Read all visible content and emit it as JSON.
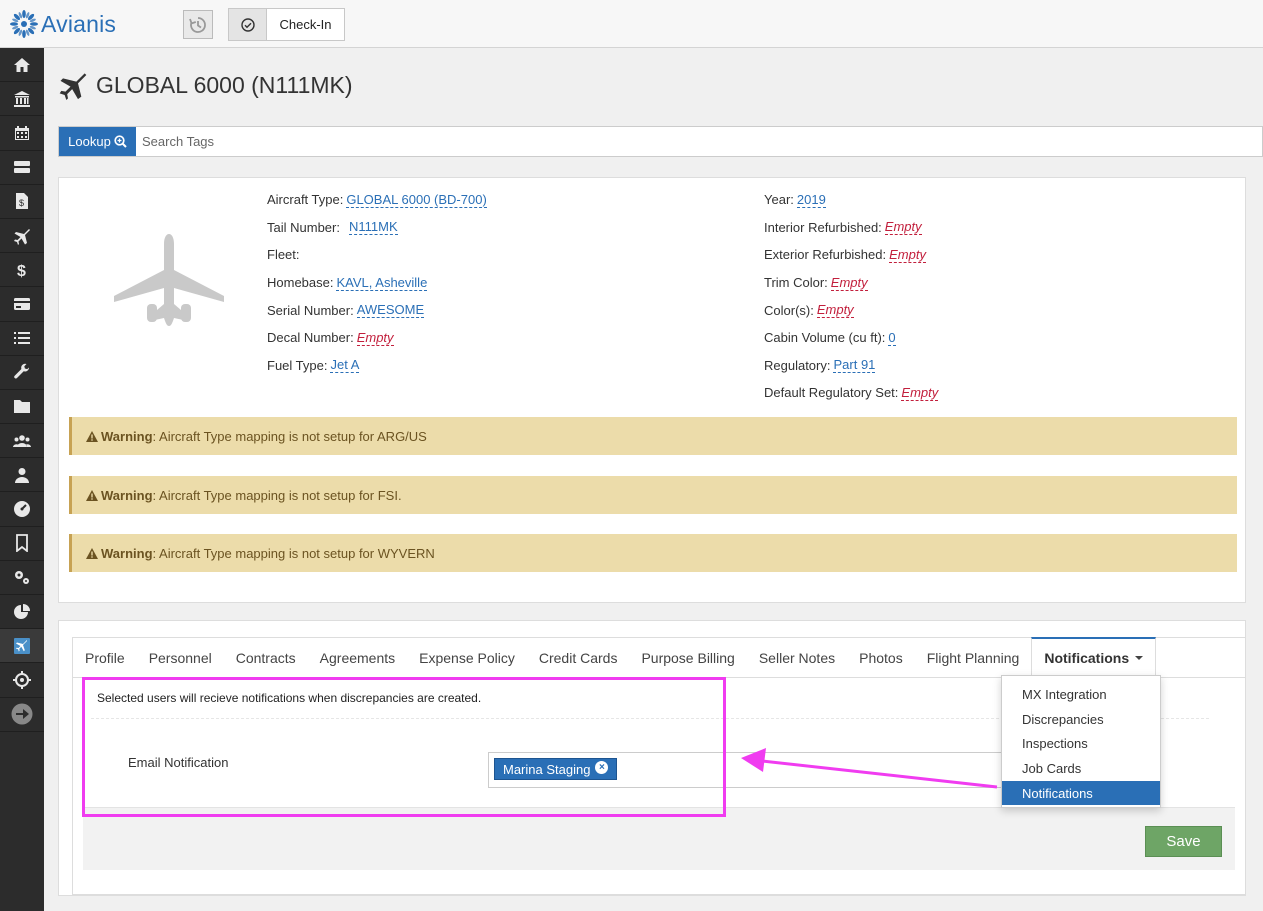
{
  "app": {
    "brand": "Avianis",
    "checkin_label": "Check-In",
    "brand_color": "#2a6fb6"
  },
  "sidebar": {
    "items": [
      "home-icon",
      "bank-icon",
      "calendar-icon",
      "server-icon",
      "invoice-icon",
      "plane-icon",
      "dollar-icon",
      "credit-card-icon",
      "list-icon",
      "wrench-icon",
      "folder-icon",
      "users-icon",
      "user-icon",
      "dashboard-icon",
      "bookmark-icon",
      "cogs-icon",
      "pie-chart-icon",
      "flight-map-icon",
      "crosshair-icon",
      "arrow-right-icon"
    ]
  },
  "page": {
    "title": "GLOBAL 6000 (N111MK)"
  },
  "lookup": {
    "button_label": "Lookup",
    "placeholder": "Search Tags"
  },
  "aircraft": {
    "left_fields": [
      {
        "label": "Aircraft Type:",
        "value": "GLOBAL 6000 (BD-700)"
      },
      {
        "label": "Tail Number:",
        "value": "N111MK"
      },
      {
        "label": "Fleet:",
        "value": ""
      },
      {
        "label": "Homebase:",
        "value": "KAVL, Asheville"
      },
      {
        "label": "Serial Number:",
        "value": "AWESOME"
      },
      {
        "label": "Decal Number:",
        "value": "Empty"
      },
      {
        "label": "Fuel Type:",
        "value": "Jet A"
      }
    ],
    "right_fields": [
      {
        "label": "Year:",
        "value": "2019"
      },
      {
        "label": "Interior Refurbished:",
        "value": "Empty"
      },
      {
        "label": "Exterior Refurbished:",
        "value": "Empty"
      },
      {
        "label": "Trim Color:",
        "value": "Empty"
      },
      {
        "label": "Color(s):",
        "value": "Empty"
      },
      {
        "label": "Cabin Volume (cu ft):",
        "value": "0"
      },
      {
        "label": "Regulatory:",
        "value": "Part 91"
      },
      {
        "label": "Default Regulatory Set:",
        "value": "Empty"
      }
    ]
  },
  "warnings": [
    {
      "title": "Warning",
      "text": ": Aircraft Type mapping is not setup for ARG/US"
    },
    {
      "title": "Warning",
      "text": ": Aircraft Type mapping is not setup for FSI."
    },
    {
      "title": "Warning",
      "text": ": Aircraft Type mapping is not setup for WYVERN"
    }
  ],
  "tabs": [
    "Profile",
    "Personnel",
    "Contracts",
    "Agreements",
    "Expense Policy",
    "Credit Cards",
    "Purpose Billing",
    "Seller Notes",
    "Photos",
    "Flight Planning"
  ],
  "active_tab": "Notifications",
  "notifications": {
    "description": "Selected users will recieve notifications when discrepancies are created.",
    "email_label": "Email Notification",
    "selected_user": "Marina Staging",
    "save_label": "Save"
  },
  "dropdown": {
    "items": [
      "MX Integration",
      "Discrepancies",
      "Inspections",
      "Job Cards",
      "Notifications"
    ],
    "selected": "Notifications"
  },
  "annotation": {
    "color": "#f03cf0"
  }
}
